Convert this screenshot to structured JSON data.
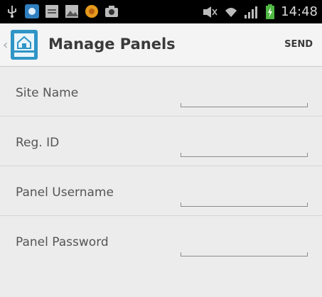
{
  "status_bar": {
    "time": "14:48",
    "left_icons": [
      "usb-icon",
      "app-badge-icon",
      "sim-icon",
      "image-icon",
      "orange-app-icon",
      "camera-icon"
    ],
    "right_icons": [
      "mute-icon",
      "wifi-icon",
      "signal-icon",
      "battery-charging-icon"
    ]
  },
  "app_bar": {
    "title": "Manage Panels",
    "action": "SEND",
    "icon": "home-app-icon",
    "back_icon": "chevron-left-icon"
  },
  "form": {
    "fields": [
      {
        "label": "Site Name",
        "value": ""
      },
      {
        "label": "Reg. ID",
        "value": ""
      },
      {
        "label": "Panel Username",
        "value": ""
      },
      {
        "label": "Panel Password",
        "value": ""
      }
    ]
  },
  "colors": {
    "accent": "#2f95c7",
    "background": "#ececec",
    "text": "#3a3a3a"
  }
}
